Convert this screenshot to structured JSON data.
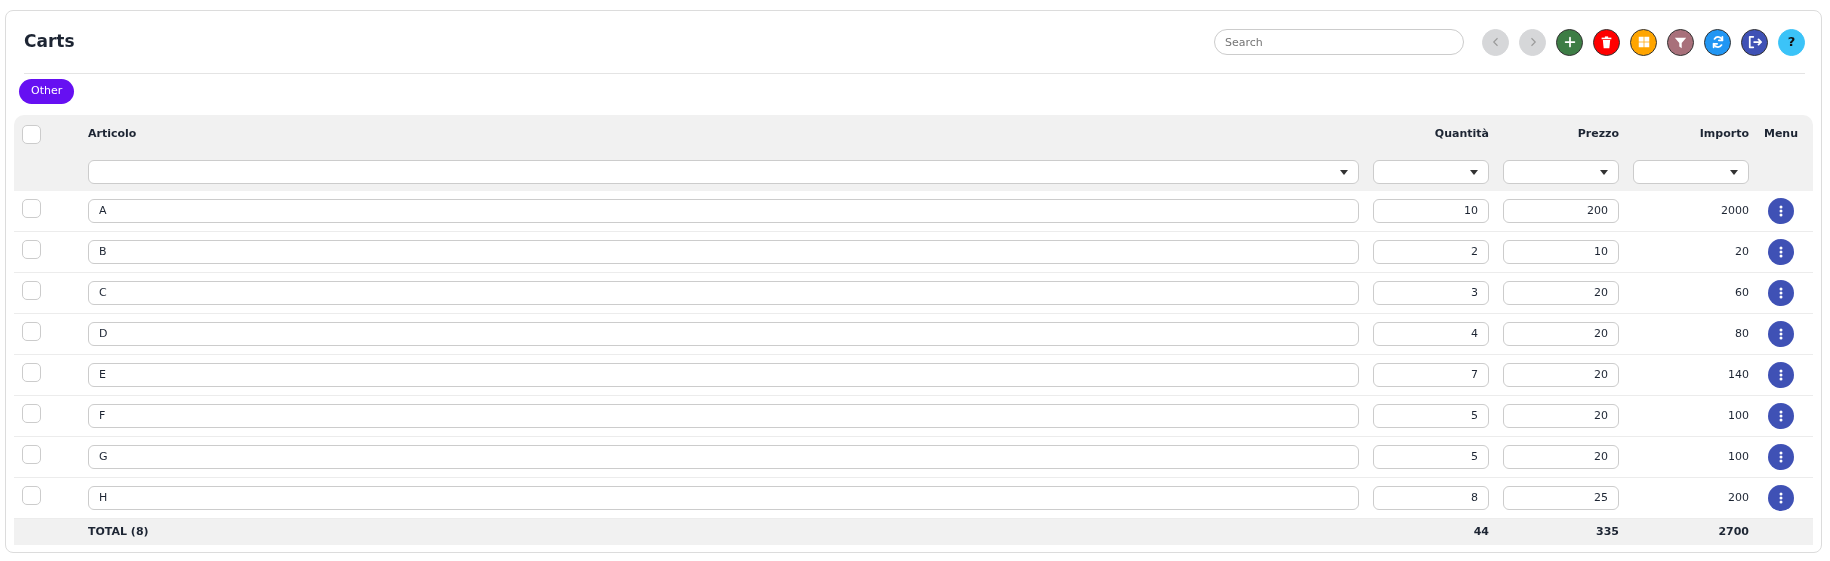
{
  "title": "Carts",
  "search": {
    "placeholder": "Search"
  },
  "toolbar": [
    {
      "kind": "prev",
      "disabled": true
    },
    {
      "kind": "next",
      "disabled": true
    },
    {
      "kind": "add",
      "disabled": false
    },
    {
      "kind": "delete",
      "disabled": false
    },
    {
      "kind": "grid",
      "disabled": false
    },
    {
      "kind": "filter",
      "disabled": false
    },
    {
      "kind": "refresh",
      "disabled": false
    },
    {
      "kind": "exit",
      "disabled": false
    },
    {
      "kind": "help",
      "disabled": false,
      "label": "?"
    }
  ],
  "filter_tabs": [
    {
      "label": "Other",
      "selected": true
    }
  ],
  "table": {
    "select_all": {
      "checked": false
    },
    "columns": [
      "Articolo",
      "Quantità",
      "Prezzo",
      "Importo",
      "Menu"
    ],
    "rows": [
      {
        "checked": false,
        "articolo": "A",
        "quantita": "10",
        "prezzo": "200",
        "importo": "2000"
      },
      {
        "checked": false,
        "articolo": "B",
        "quantita": "2",
        "prezzo": "10",
        "importo": "20"
      },
      {
        "checked": false,
        "articolo": "C",
        "quantita": "3",
        "prezzo": "20",
        "importo": "60"
      },
      {
        "checked": false,
        "articolo": "D",
        "quantita": "4",
        "prezzo": "20",
        "importo": "80"
      },
      {
        "checked": false,
        "articolo": "E",
        "quantita": "7",
        "prezzo": "20",
        "importo": "140"
      },
      {
        "checked": false,
        "articolo": "F",
        "quantita": "5",
        "prezzo": "20",
        "importo": "100"
      },
      {
        "checked": false,
        "articolo": "G",
        "quantita": "5",
        "prezzo": "20",
        "importo": "100"
      },
      {
        "checked": false,
        "articolo": "H",
        "quantita": "8",
        "prezzo": "25",
        "importo": "200"
      }
    ],
    "footer": {
      "label": "TOTAL (8)",
      "quantita": "44",
      "prezzo": "335",
      "importo": "2700"
    }
  }
}
